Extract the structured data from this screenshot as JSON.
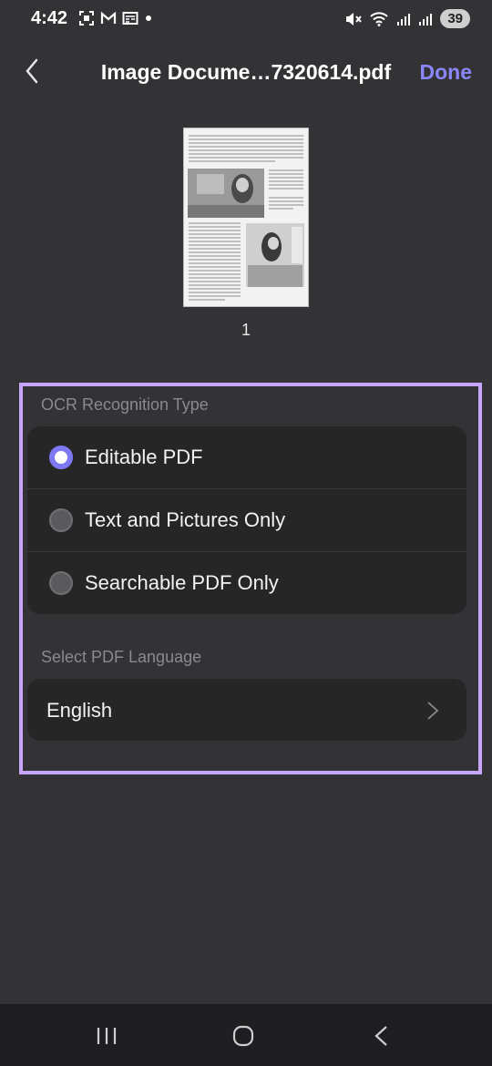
{
  "status": {
    "time": "4:42",
    "battery": "39",
    "left_icons": [
      "screenshot-icon",
      "gmail-icon",
      "news-icon",
      "dot-icon"
    ],
    "right_icons": [
      "mute-icon",
      "wifi-icon",
      "signal-icon",
      "signal-icon"
    ]
  },
  "header": {
    "title": "Image Docume…7320614.pdf",
    "done_label": "Done"
  },
  "preview": {
    "page_number": "1"
  },
  "ocr": {
    "section_label": "OCR Recognition Type",
    "options": [
      {
        "label": "Editable PDF",
        "selected": true
      },
      {
        "label": "Text and Pictures Only",
        "selected": false
      },
      {
        "label": "Searchable PDF Only",
        "selected": false
      }
    ]
  },
  "language": {
    "section_label": "Select PDF Language",
    "value": "English"
  },
  "colors": {
    "accent": "#7e78f5",
    "done": "#8c86ff",
    "highlight": "#c8a6ff",
    "background": "#333335",
    "card": "#262627"
  }
}
